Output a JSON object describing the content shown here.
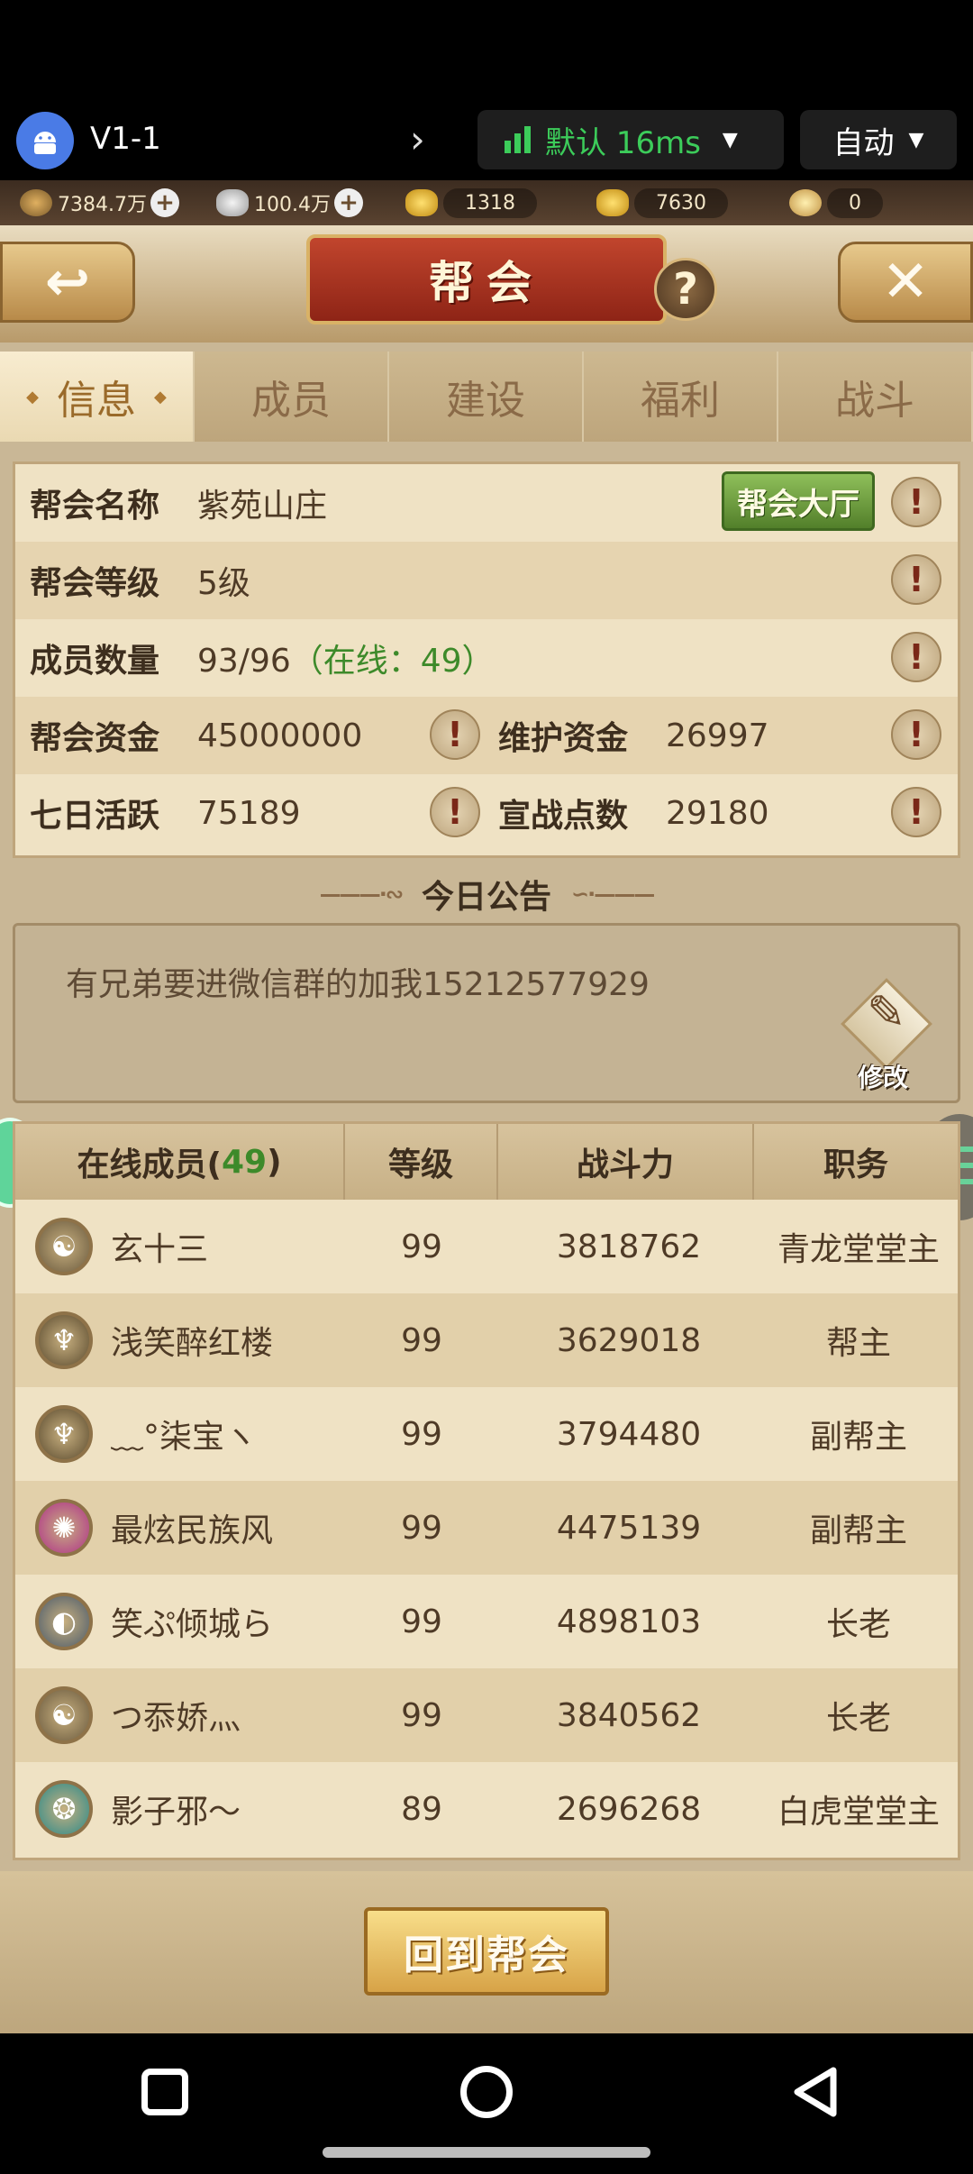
{
  "stream": {
    "device_name": "V1-1",
    "network_label": "默认 16ms",
    "mode_label": "自动",
    "network_color": "#3ccc5a"
  },
  "resources": [
    {
      "icon": "copper-coin-icon",
      "value": "7384.7万",
      "has_plus": true
    },
    {
      "icon": "silver-ingot-icon",
      "value": "100.4万",
      "has_plus": true
    },
    {
      "icon": "gold-ingot-icon",
      "value": "1318",
      "has_plus": false
    },
    {
      "icon": "locked-gold-ingot-icon",
      "value": "7630",
      "has_plus": false
    },
    {
      "icon": "token-coin-icon",
      "value": "0",
      "has_plus": false
    }
  ],
  "header": {
    "title": "帮会",
    "help_glyph": "?",
    "close_glyph": "✕",
    "back_glyph": "↩"
  },
  "tabs": [
    {
      "label": "信息",
      "active": true
    },
    {
      "label": "成员",
      "active": false
    },
    {
      "label": "建设",
      "active": false
    },
    {
      "label": "福利",
      "active": false
    },
    {
      "label": "战斗",
      "active": false
    }
  ],
  "info": {
    "guild_name_label": "帮会名称",
    "guild_name": "紫苑山庄",
    "hall_button": "帮会大厅",
    "guild_level_label": "帮会等级",
    "guild_level": "5级",
    "member_count_label": "成员数量",
    "member_count": "93/96",
    "online_text": "（在线：49）",
    "funds_label": "帮会资金",
    "funds": "45000000",
    "maintenance_label": "维护资金",
    "maintenance": "26997",
    "weekly_active_label": "七日活跃",
    "weekly_active": "75189",
    "war_points_label": "宣战点数",
    "war_points": "29180",
    "excl_glyph": "!"
  },
  "notice": {
    "title": "今日公告",
    "text": "有兄弟要进微信群的加我15212577929",
    "edit_label": "修改"
  },
  "members": {
    "headers": {
      "online_prefix": "在线成员(",
      "online_count": "49",
      "online_suffix": ")",
      "level": "等级",
      "power": "战斗力",
      "role": "职务"
    },
    "rows": [
      {
        "name": "玄十三",
        "level": "99",
        "power": "3818762",
        "role": "青龙堂堂主",
        "avatar_color": "#6a5a3e"
      },
      {
        "name": "浅笑醉红楼",
        "level": "99",
        "power": "3629018",
        "role": "帮主",
        "avatar_color": "#5a4a2e"
      },
      {
        "name": "﹏°柒宝ヽ",
        "level": "99",
        "power": "3794480",
        "role": "副帮主",
        "avatar_color": "#5a4a2e"
      },
      {
        "name": "最炫民族风",
        "level": "99",
        "power": "4475139",
        "role": "副帮主",
        "avatar_color": "#b0308a"
      },
      {
        "name": "笑ぷ倾城ら",
        "level": "99",
        "power": "4898103",
        "role": "长老",
        "avatar_color": "#4a5a6a"
      },
      {
        "name": "つ忝娇灬",
        "level": "99",
        "power": "3840562",
        "role": "长老",
        "avatar_color": "#6a5a3e"
      },
      {
        "name": "影子邪～",
        "level": "89",
        "power": "2696268",
        "role": "白虎堂堂主",
        "avatar_color": "#2a8a8a"
      }
    ]
  },
  "footer": {
    "return_button": "回到帮会"
  }
}
